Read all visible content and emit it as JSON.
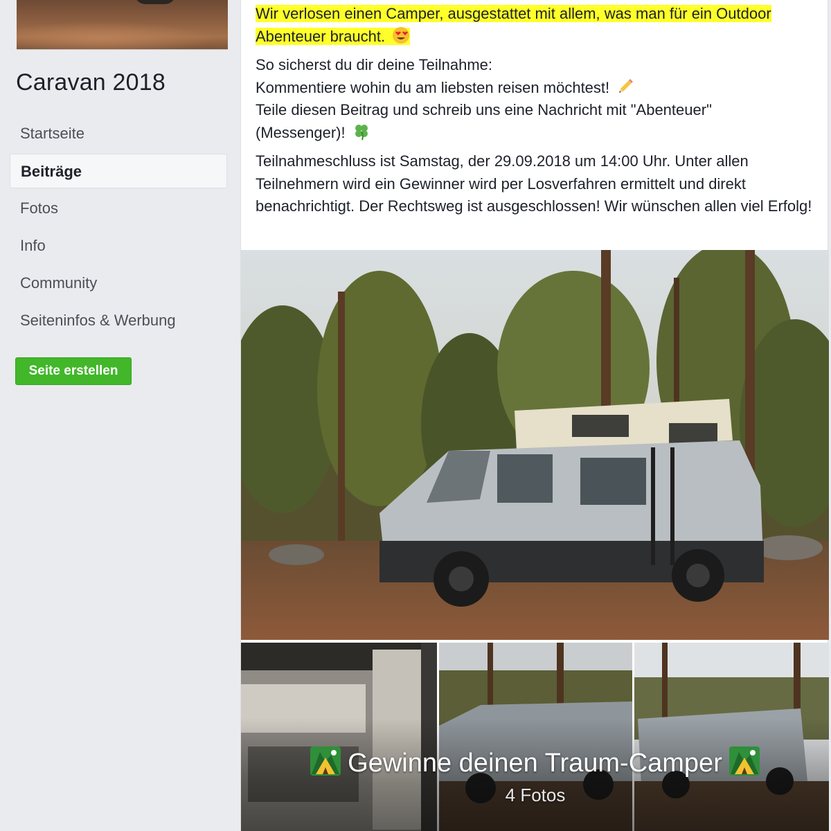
{
  "sidebar": {
    "page_name": "Caravan 2018",
    "nav_items": [
      {
        "label": "Startseite"
      },
      {
        "label": "Beiträge"
      },
      {
        "label": "Fotos"
      },
      {
        "label": "Info"
      },
      {
        "label": "Community"
      },
      {
        "label": "Seiteninfos & Werbung"
      }
    ],
    "active_item": "Beiträge",
    "create_page_button": "Seite erstellen"
  },
  "post": {
    "intro_line1": "Wir verlosen einen Camper, ausgestattet mit allem, was man für ein Outdoor",
    "intro_line2": "Abenteuer braucht.",
    "how_to_title": "So sicherst du dir deine Teilnahme:",
    "how_to_step1": "Kommentiere wohin du am liebsten reisen möchtest!",
    "how_to_step2_line1": "Teile diesen Beitrag und schreib uns eine Nachricht mit \"Abenteuer\"",
    "how_to_step2_line2": "(Messenger)!",
    "terms": "Teilnahmeschluss ist Samstag, der 29.09.2018 um 14:00 Uhr. Unter allen Teilnehmern wird ein Gewinner wird per Losverfahren ermittelt und direkt benachrichtigt. Der Rechtsweg ist ausgeschlossen! Wir wünschen allen viel Erfolg!"
  },
  "album": {
    "title": "Gewinne deinen Traum-Camper",
    "photo_count": "4 Fotos"
  },
  "colors": {
    "highlight": "#ffff2a",
    "create_button": "#42b72a",
    "page_background": "#e9ebee"
  }
}
